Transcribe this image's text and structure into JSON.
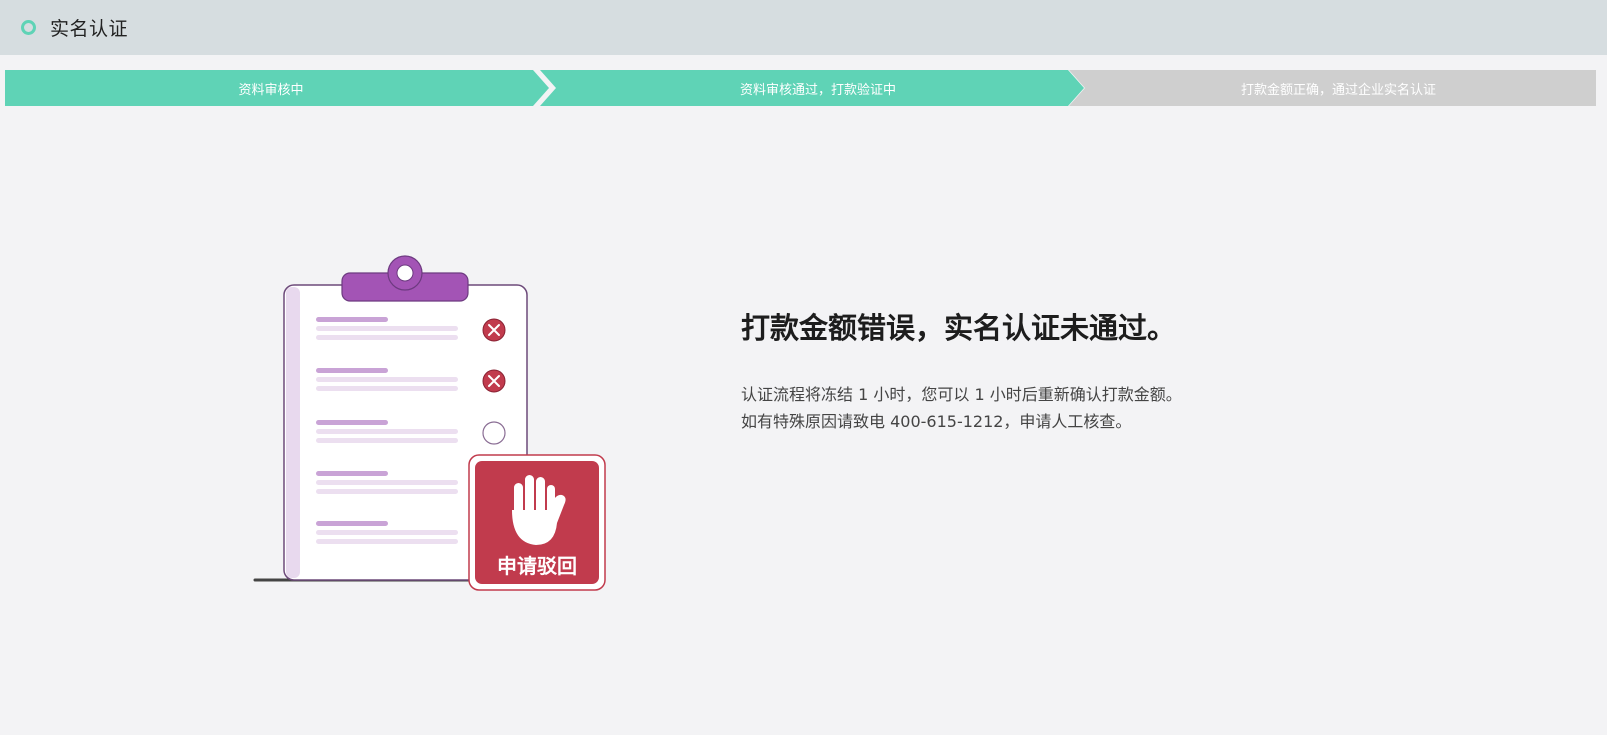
{
  "header": {
    "title": "实名认证",
    "accent_color": "#5fd3b6"
  },
  "steps": [
    {
      "label": "资料审核中",
      "state": "done"
    },
    {
      "label": "资料审核通过，打款验证中",
      "state": "done"
    },
    {
      "label": "打款金额正确，通过企业实名认证",
      "state": "pending"
    }
  ],
  "illustration": {
    "badge_text": "申请驳回",
    "icon": "clipboard-rejected",
    "badge_color": "#c13b4d",
    "clip_color": "#a354b5"
  },
  "message": {
    "title": "打款金额错误，实名认证未通过。",
    "line1": "认证流程将冻结 1 小时，您可以 1 小时后重新确认打款金额。",
    "line2": "如有特殊原因请致电 400-615-1212，申请人工核查。"
  }
}
